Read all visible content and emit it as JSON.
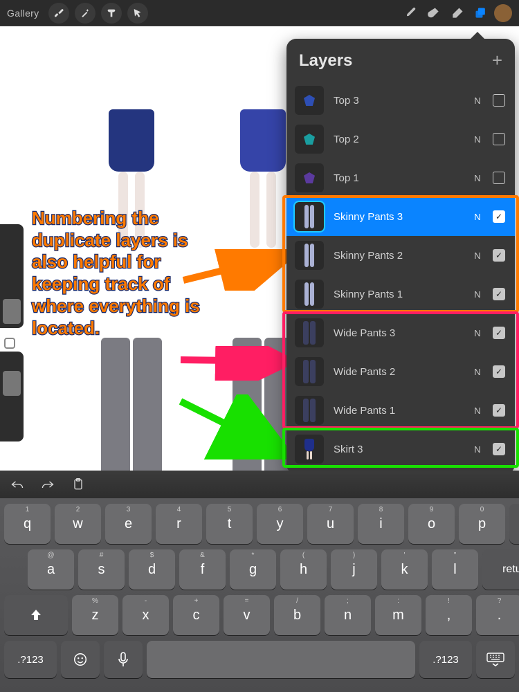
{
  "topbar": {
    "gallery_label": "Gallery",
    "swatch_color": "#8a6136"
  },
  "annotation_text": "Numbering the duplicate layers is also helpful for keeping track of where everything is located.",
  "arrows": [
    {
      "color": "#ff7a00",
      "to": "skinny_pants_group"
    },
    {
      "color": "#ff1e63",
      "to": "wide_pants_group"
    },
    {
      "color": "#18e000",
      "to": "skirt_group"
    }
  ],
  "layers_panel": {
    "title": "Layers",
    "layers": [
      {
        "name": "Top 3",
        "blend": "N",
        "visible": false,
        "selected": false,
        "thumb": "top-blue"
      },
      {
        "name": "Top 2",
        "blend": "N",
        "visible": false,
        "selected": false,
        "thumb": "top-teal"
      },
      {
        "name": "Top 1",
        "blend": "N",
        "visible": false,
        "selected": false,
        "thumb": "top-purple"
      },
      {
        "name": "Skinny Pants 3",
        "blend": "N",
        "visible": true,
        "selected": true,
        "thumb": "skinny"
      },
      {
        "name": "Skinny Pants 2",
        "blend": "N",
        "visible": true,
        "selected": false,
        "thumb": "skinny"
      },
      {
        "name": "Skinny Pants 1",
        "blend": "N",
        "visible": true,
        "selected": false,
        "thumb": "skinny"
      },
      {
        "name": "Wide Pants 3",
        "blend": "N",
        "visible": true,
        "selected": false,
        "thumb": "wide"
      },
      {
        "name": "Wide Pants 2",
        "blend": "N",
        "visible": true,
        "selected": false,
        "thumb": "wide"
      },
      {
        "name": "Wide Pants 1",
        "blend": "N",
        "visible": true,
        "selected": false,
        "thumb": "wide"
      },
      {
        "name": "Skirt 3",
        "blend": "N",
        "visible": true,
        "selected": false,
        "thumb": "skirt"
      }
    ],
    "highlights": [
      {
        "color": "#ff7a00",
        "start_index": 3,
        "row_count": 3
      },
      {
        "color": "#ff1e63",
        "start_index": 6,
        "row_count": 3
      },
      {
        "color": "#18e000",
        "start_index": 9,
        "row_count": 1
      }
    ]
  },
  "keyboard": {
    "row1": [
      {
        "label": "q",
        "hint": "1"
      },
      {
        "label": "w",
        "hint": "2"
      },
      {
        "label": "e",
        "hint": "3"
      },
      {
        "label": "r",
        "hint": "4"
      },
      {
        "label": "t",
        "hint": "5"
      },
      {
        "label": "y",
        "hint": "6"
      },
      {
        "label": "u",
        "hint": "7"
      },
      {
        "label": "i",
        "hint": "8"
      },
      {
        "label": "o",
        "hint": "9"
      },
      {
        "label": "p",
        "hint": "0"
      }
    ],
    "row2": [
      {
        "label": "a",
        "hint": "@"
      },
      {
        "label": "s",
        "hint": "#"
      },
      {
        "label": "d",
        "hint": "$"
      },
      {
        "label": "f",
        "hint": "&"
      },
      {
        "label": "g",
        "hint": "*"
      },
      {
        "label": "h",
        "hint": "("
      },
      {
        "label": "j",
        "hint": ")"
      },
      {
        "label": "k",
        "hint": "'"
      },
      {
        "label": "l",
        "hint": "\""
      }
    ],
    "return_label": "return",
    "row3": [
      {
        "label": "z",
        "hint": "%"
      },
      {
        "label": "x",
        "hint": "-"
      },
      {
        "label": "c",
        "hint": "+"
      },
      {
        "label": "v",
        "hint": "="
      },
      {
        "label": "b",
        "hint": "/"
      },
      {
        "label": "n",
        "hint": ";"
      },
      {
        "label": "m",
        "hint": ":"
      },
      {
        "label": ",",
        "hint": "!"
      },
      {
        "label": ".",
        "hint": "?"
      }
    ],
    "sym_label": ".?123"
  }
}
